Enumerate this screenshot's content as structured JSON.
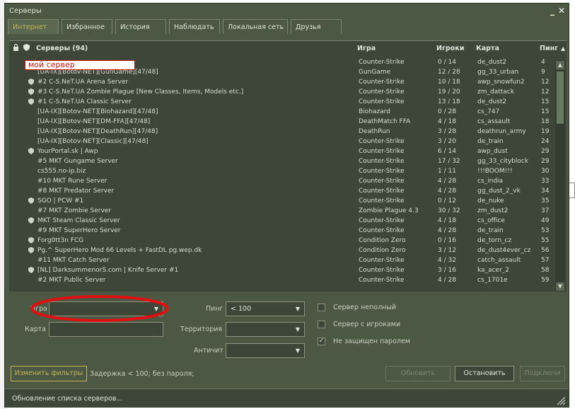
{
  "window": {
    "title": "Серверы",
    "minimize": "_",
    "close": "✕"
  },
  "tabs": [
    {
      "label": "Интернет",
      "active": true
    },
    {
      "label": "Избранное",
      "active": false
    },
    {
      "label": "История",
      "active": false
    },
    {
      "label": "Наблюдать",
      "active": false
    },
    {
      "label": "Локальная сеть",
      "active": false
    },
    {
      "label": "Друзья",
      "active": false
    }
  ],
  "columns": {
    "servers": "Серверы (94)",
    "game": "Игра",
    "players": "Игроки",
    "map": "Карта",
    "ping": "Пинг",
    "sort_arrow": "▲"
  },
  "annotation": {
    "text": "мой сервер",
    "color": "#cc1010"
  },
  "rows": [
    {
      "name": "",
      "game": "Counter-Strike",
      "players": "0 / 14",
      "map": "de_dust2",
      "ping": "4",
      "icon": false
    },
    {
      "name": "[UA-IX][Botov-NET][GunGame][47/48]",
      "game": "GunGame",
      "players": "12 / 28",
      "map": "gg_33_urban",
      "ping": "9",
      "icon": false
    },
    {
      "name": "#2 C-S.NeT.UA Arena Server",
      "game": "Counter-Strike",
      "players": "10 / 18",
      "map": "awp_snowfun2",
      "ping": "12",
      "icon": true
    },
    {
      "name": "#3 C-S.NeT.UA Zombie Plague [New Classes, Items, Models etc.]",
      "game": "Counter-Strike",
      "players": "19 / 20",
      "map": "zm_dattack",
      "ping": "12",
      "icon": true
    },
    {
      "name": "#1 C-S.NeT.UA Classic Server",
      "game": "Counter-Strike",
      "players": "13 / 18",
      "map": "de_dust2",
      "ping": "15",
      "icon": true
    },
    {
      "name": "[UA-IX][Botov-NET][Biohazard][47/48]",
      "game": "Biohazard",
      "players": "0 / 28",
      "map": "cs_747",
      "ping": "15",
      "icon": false
    },
    {
      "name": "[UA-IX][Botov-NET][DM-FFA][47/48]",
      "game": "DeathMatch FFA",
      "players": "4 / 18",
      "map": "cs_assault",
      "ping": "18",
      "icon": false
    },
    {
      "name": "[UA-IX][Botov-NET][DeathRun][47/48]",
      "game": "DeathRun",
      "players": "3 / 28",
      "map": "deathrun_army",
      "ping": "19",
      "icon": false
    },
    {
      "name": "[UA-IX][Botov-NET][Classic][47/48]",
      "game": "Counter-Strike",
      "players": "3 / 20",
      "map": "de_train",
      "ping": "24",
      "icon": false
    },
    {
      "name": "YourPortal.sk | Awp",
      "game": "Counter-Strike",
      "players": "6 / 14",
      "map": "awp_dust",
      "ping": "29",
      "icon": true
    },
    {
      "name": "#5 MKT Gungame Server",
      "game": "Counter-Strike",
      "players": "17 / 32",
      "map": "gg_33_cityblock",
      "ping": "29",
      "icon": false
    },
    {
      "name": "cs555.no-ip.biz",
      "game": "Counter-Strike",
      "players": "1 / 11",
      "map": "!!!BOOM!!!",
      "ping": "30",
      "icon": false
    },
    {
      "name": "#10 MKT Rune Server",
      "game": "Counter-Strike",
      "players": "4 / 28",
      "map": "cs_india",
      "ping": "33",
      "icon": false
    },
    {
      "name": "#8 MKT Predator Server",
      "game": "Counter-Strike",
      "players": "4 / 28",
      "map": "gg_dust_2_vk",
      "ping": "34",
      "icon": false
    },
    {
      "name": "SGO | PCW #1",
      "game": "Counter-Strike",
      "players": "0 / 12",
      "map": "de_nuke",
      "ping": "35",
      "icon": true
    },
    {
      "name": "#7 MKT Zombie Server",
      "game": "Zombie Plague 4.3",
      "players": "30 / 32",
      "map": "zm_dust2",
      "ping": "37",
      "icon": false
    },
    {
      "name": "MKT Steam Classic Server",
      "game": "Counter-Strike",
      "players": "4 / 18",
      "map": "cs_office",
      "ping": "49",
      "icon": true
    },
    {
      "name": "#9 MKT SuperHero Server",
      "game": "Counter-Strike",
      "players": "4 / 28",
      "map": "de_train",
      "ping": "53",
      "icon": false
    },
    {
      "name": "Forg0tt3n FCG",
      "game": "Condition Zero",
      "players": "0 / 16",
      "map": "de_torn_cz",
      "ping": "55",
      "icon": true
    },
    {
      "name": "Pg.^ SuperHero Mod 66 Levels + FastDL pg.wep.dk",
      "game": "Condition Zero",
      "players": "3 / 12",
      "map": "de_dust4ever_cz",
      "ping": "56",
      "icon": true
    },
    {
      "name": "#11 MKT Catch Server",
      "game": "Counter-Strike",
      "players": "4 / 32",
      "map": "catch_assault",
      "ping": "57",
      "icon": false
    },
    {
      "name": "[NL] DarksummenorS.com | Knife Server #1",
      "game": "Counter-Strike",
      "players": "3 / 16",
      "map": "ka_acer_2",
      "ping": "58",
      "icon": true
    },
    {
      "name": "#2 MKT Public Server",
      "game": "Counter-Strike",
      "players": "4 / 28",
      "map": "cs_1701e",
      "ping": "59",
      "icon": false
    }
  ],
  "filters": {
    "game_label": "Игра",
    "game_value": "",
    "map_label": "Карта",
    "map_value": "",
    "ping_label": "Пинг",
    "ping_value": "< 100",
    "territory_label": "Территория",
    "territory_value": "",
    "anticheat_label": "Античит",
    "anticheat_value": "",
    "not_full": {
      "label": "Сервер неполный",
      "checked": false
    },
    "has_players": {
      "label": "Сервер с игроками",
      "checked": false
    },
    "no_password": {
      "label": "Не защищен паролем",
      "checked": true
    }
  },
  "buttons": {
    "change_filters": "Изменить фильтры",
    "filter_summary": "Задержка < 100; без пароля;",
    "refresh": "Обновить",
    "stop": "Остановить",
    "connect": "Подключи"
  },
  "status": "Обновление списка серверов...",
  "colors": {
    "window_bg": "#4c5844",
    "list_bg": "#3e4637",
    "accent_tab": "#c4b550",
    "highlight_red": "#e01010"
  }
}
